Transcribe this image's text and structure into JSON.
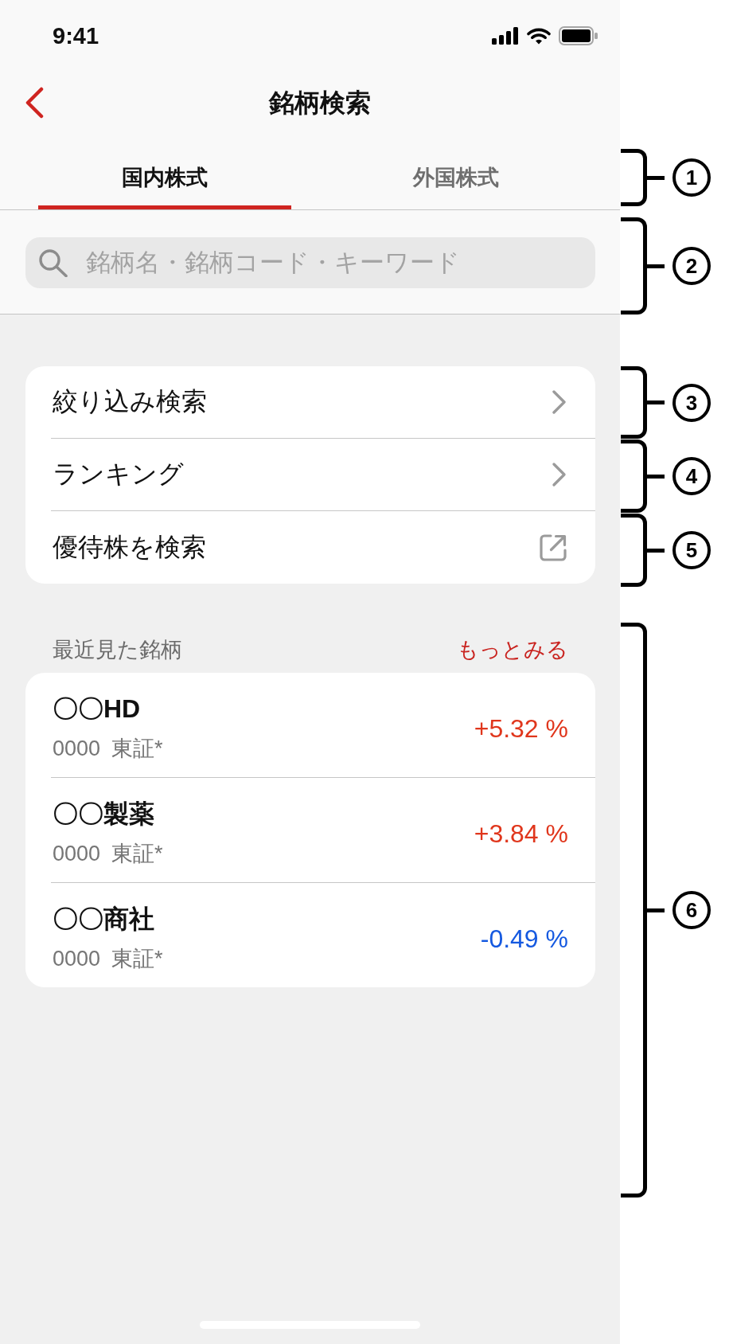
{
  "status_bar": {
    "time": "9:41"
  },
  "nav": {
    "title": "銘柄検索"
  },
  "tabs": [
    {
      "label": "国内株式",
      "selected": true
    },
    {
      "label": "外国株式",
      "selected": false
    }
  ],
  "search": {
    "placeholder": "銘柄名・銘柄コード・キーワード"
  },
  "menu": [
    {
      "label": "絞り込み検索",
      "kind": "chevron"
    },
    {
      "label": "ランキング",
      "kind": "chevron"
    },
    {
      "label": "優待株を検索",
      "kind": "external"
    }
  ],
  "recent": {
    "title": "最近見た銘柄",
    "more_link": "もっとみる",
    "items": [
      {
        "name": "〇〇HD",
        "code": "0000",
        "market": "東証*",
        "change": "+5.32 %",
        "kind": "up"
      },
      {
        "name": "〇〇製薬",
        "code": "0000",
        "market": "東証*",
        "change": "+3.84 %",
        "kind": "up"
      },
      {
        "name": "〇〇商社",
        "code": "0000",
        "market": "東証*",
        "change": "-0.49 %",
        "kind": "down"
      }
    ]
  },
  "annotations": [
    {
      "number": "1"
    },
    {
      "number": "2"
    },
    {
      "number": "3"
    },
    {
      "number": "4"
    },
    {
      "number": "5"
    },
    {
      "number": "6"
    }
  ]
}
